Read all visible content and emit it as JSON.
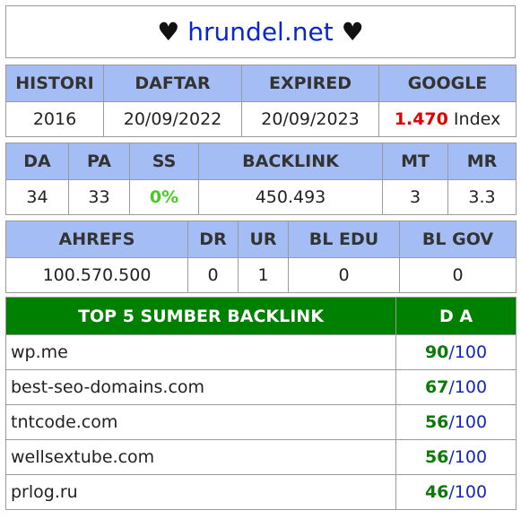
{
  "title": {
    "prefix": "♥",
    "site": "hrundel.net",
    "suffix": "♥"
  },
  "info": {
    "headers": [
      "HISTORI",
      "DAFTAR",
      "EXPIRED",
      "GOOGLE"
    ],
    "values": {
      "histori": "2016",
      "daftar": "20/09/2022",
      "expired": "20/09/2023",
      "google_count": "1.470",
      "google_suffix": "Index"
    }
  },
  "metrics": {
    "headers": [
      "DA",
      "PA",
      "SS",
      "BACKLINK",
      "MT",
      "MR"
    ],
    "values": [
      "34",
      "33",
      "0%",
      "450.493",
      "3",
      "3.3"
    ]
  },
  "ahrefs": {
    "headers": [
      "AHREFS",
      "DR",
      "UR",
      "BL EDU",
      "BL GOV"
    ],
    "values": [
      "100.570.500",
      "0",
      "1",
      "0",
      "0"
    ]
  },
  "backlinks": {
    "headers": [
      "TOP 5 SUMBER BACKLINK",
      "D A"
    ],
    "rows": [
      {
        "domain": "wp.me",
        "da": "90",
        "max": "/100"
      },
      {
        "domain": "best-seo-domains.com",
        "da": "67",
        "max": "/100"
      },
      {
        "domain": "tntcode.com",
        "da": "56",
        "max": "/100"
      },
      {
        "domain": "wellsextube.com",
        "da": "56",
        "max": "/100"
      },
      {
        "domain": "prlog.ru",
        "da": "46",
        "max": "/100"
      }
    ]
  },
  "colors": {
    "header_bg": "#a4bdf4",
    "green_header": "#008000",
    "google_count": "#e00000",
    "ss_value": "#44cc22",
    "site_title": "#0b27c4"
  }
}
